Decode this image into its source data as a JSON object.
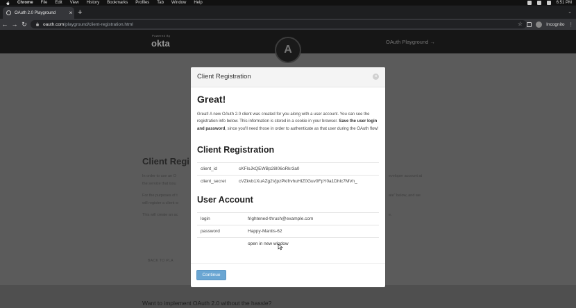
{
  "menubar": {
    "items": [
      "Chrome",
      "File",
      "Edit",
      "View",
      "History",
      "Bookmarks",
      "Profiles",
      "Tab",
      "Window",
      "Help"
    ],
    "clock": "6:51 PM"
  },
  "browser": {
    "tab_title": "OAuth 2.0 Playground",
    "url_host": "oauth.com",
    "url_path": "/playground/client-registration.html",
    "profile_label": "Incognito"
  },
  "site": {
    "powered_by": "Powered By",
    "brand": "okta",
    "nav_link": "OAuth Playground →"
  },
  "background": {
    "title": "Client Regi",
    "para1_left": "In order to use an O",
    "para1_left2": "the service that issu",
    "para1_right": "eveloper account at",
    "para2_left": "For the purposes of t",
    "para2_left2": "will register a client w",
    "para2_right": "ate\" below, and we",
    "para3_left": "This will create an ac",
    "para3_right": "e.",
    "back_link": "BACK TO PLA",
    "footer_heading": "Want to implement OAuth 2.0 without the hassle?"
  },
  "modal": {
    "title": "Client Registration",
    "heading": "Great!",
    "intro_1": "Great! A new OAuth 2.0 client was created for you along with a user account. You can see the registration info below. This information is stored in a cookie in your browser. ",
    "intro_bold": "Save the user login and password",
    "intro_2": ", since you'll need those in order to authenticate as that user during the OAuth flow!",
    "client_section": "Client Registration",
    "client_rows": [
      {
        "key": "client_id",
        "value": "cKFloJkQEWBp28I06oRkr3a0"
      },
      {
        "key": "client_secret",
        "value": "cVZkvb1XuAZg2VjpzPkifrvhuHIZ0Guv0FpY0a1Dhlc7MVn_"
      }
    ],
    "user_section": "User Account",
    "user_rows": [
      {
        "key": "login",
        "value": "frightened-thrush@example.com"
      },
      {
        "key": "password",
        "value": "Happy-Mantis-62"
      },
      {
        "key": "",
        "value": "open in new window"
      }
    ],
    "continue_label": "Continue"
  }
}
